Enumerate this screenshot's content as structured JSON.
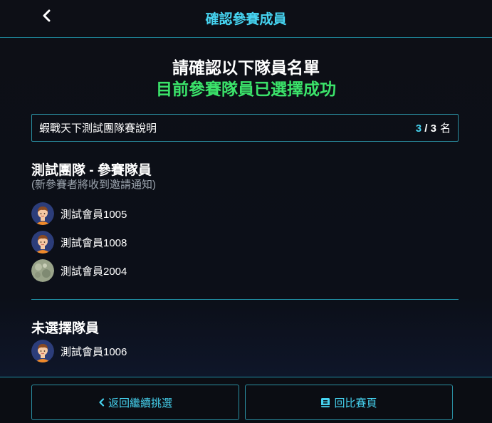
{
  "header": {
    "title": "確認參賽成員",
    "back_icon": "chevron-left-icon"
  },
  "confirm": {
    "title": "請確認以下隊員名單",
    "success": "目前參賽隊員已選擇成功"
  },
  "event": {
    "name": "蝦戰天下測試團隊賽說明",
    "count_current": "3",
    "count_sep": " / ",
    "count_total": "3",
    "count_unit": "名"
  },
  "team": {
    "title": "測試團隊 - 參賽隊員",
    "note": "(新參賽者將收到邀請通知)",
    "members": [
      {
        "name": "測試會員1005",
        "avatar": "cartoon-boy-avatar"
      },
      {
        "name": "測試會員1008",
        "avatar": "cartoon-boy-avatar"
      },
      {
        "name": "測試會員2004",
        "avatar": "photo-avatar"
      }
    ]
  },
  "unselected": {
    "title": "未選擇隊員",
    "members": [
      {
        "name": "測試會員1006",
        "avatar": "cartoon-boy-avatar"
      }
    ]
  },
  "footer": {
    "back_label": "返回繼續挑選",
    "back_icon": "chevron-left-icon",
    "return_label": "回比賽頁",
    "return_icon": "book-icon"
  },
  "colors": {
    "accent": "#46d3f0",
    "success": "#3be36a",
    "border": "#1f8ea3",
    "background": "#0d0f16"
  }
}
